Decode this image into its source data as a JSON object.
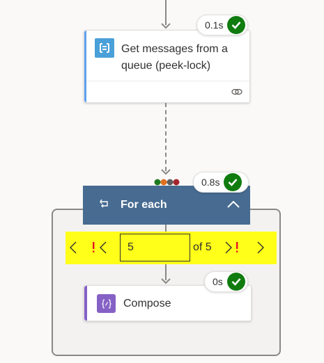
{
  "get_messages": {
    "title_line1": "Get messages from a",
    "title_line2": "queue (peek-lock)",
    "duration": "0.1s",
    "icon": "service-bus-queue-icon",
    "footer_icon": "link-icon",
    "accent": "#5ea0ef",
    "icon_bg": "#4aa0d8"
  },
  "foreach": {
    "title": "For each",
    "duration": "0.8s",
    "header_color": "#476b91",
    "status_dots": [
      "#1f7a1f",
      "#e07020",
      "#605e5c",
      "#a4262c"
    ],
    "pager": {
      "current": "5",
      "of_text": "of 5",
      "highlight": "#ffff1a"
    }
  },
  "compose": {
    "title": "Compose",
    "duration": "0s",
    "accent": "#8661c5",
    "icon": "compose-icon"
  },
  "colors": {
    "success": "#107c10",
    "error_mark": "#e81123"
  }
}
